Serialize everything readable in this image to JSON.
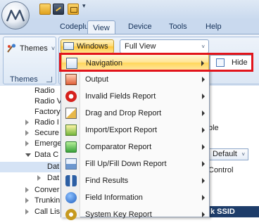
{
  "quick_access": {
    "icons": [
      "motorola-logo-icon",
      "open-folder-icon",
      "tool-icon",
      "write-icon"
    ],
    "dropdown_glyph": "▾"
  },
  "ribbon": {
    "tabs": [
      "Codeplug",
      "View",
      "Device",
      "Tools",
      "Help"
    ],
    "active_tab": "View",
    "themes_button": "Themes",
    "themes_group_label": "Themes",
    "windows_button": "Windows",
    "view_select_value": "Full View",
    "dropdown_arrow": "˅"
  },
  "tree": {
    "items": [
      {
        "label": "Radio",
        "expander": "none"
      },
      {
        "label": "Radio V",
        "expander": "none"
      },
      {
        "label": "Factory",
        "expander": "none"
      },
      {
        "label": "Radio I",
        "expander": "collapsed"
      },
      {
        "label": "Secure",
        "expander": "collapsed"
      },
      {
        "label": "Emerge",
        "expander": "collapsed"
      },
      {
        "label": "Data C",
        "expander": "expanded"
      },
      {
        "label": "Dat",
        "expander": "none",
        "selected": true
      },
      {
        "label": "Dat",
        "expander": "collapsed"
      },
      {
        "label": "Conver",
        "expander": "collapsed"
      },
      {
        "label": "Trunkin",
        "expander": "collapsed"
      },
      {
        "label": "Call Lis",
        "expander": "collapsed"
      }
    ]
  },
  "windows_menu": {
    "items": [
      {
        "label": "Navigation",
        "icon": "window-icon",
        "has_submenu": true,
        "highlighted": true
      },
      {
        "label": "Output",
        "icon": "output-icon",
        "has_submenu": true
      },
      {
        "label": "Invalid Fields Report",
        "icon": "no-entry-icon",
        "has_submenu": true
      },
      {
        "label": "Drag and Drop Report",
        "icon": "drag-drop-icon",
        "has_submenu": true
      },
      {
        "label": "Import/Export Report",
        "icon": "import-export-icon",
        "has_submenu": true
      },
      {
        "label": "Comparator Report",
        "icon": "checkmark-icon",
        "has_submenu": true
      },
      {
        "label": "Fill Up/Fill Down Report",
        "icon": "fill-icon",
        "has_submenu": true
      },
      {
        "label": "Find Results",
        "icon": "binoculars-icon",
        "has_submenu": true
      },
      {
        "label": "Field Information",
        "icon": "info-icon",
        "has_submenu": true
      },
      {
        "label": "System Key Report",
        "icon": "key-icon",
        "has_submenu": true
      }
    ],
    "submenu": {
      "label": "Hide",
      "checked": false
    }
  },
  "right_pane": {
    "text1": "ble",
    "default_select": "Default",
    "text2": "Control",
    "banner": "k SSID"
  },
  "colors": {
    "highlight_frame": "#e2141b",
    "menu_highlight": "#ffd65a",
    "banner": "#1e3d6a"
  }
}
